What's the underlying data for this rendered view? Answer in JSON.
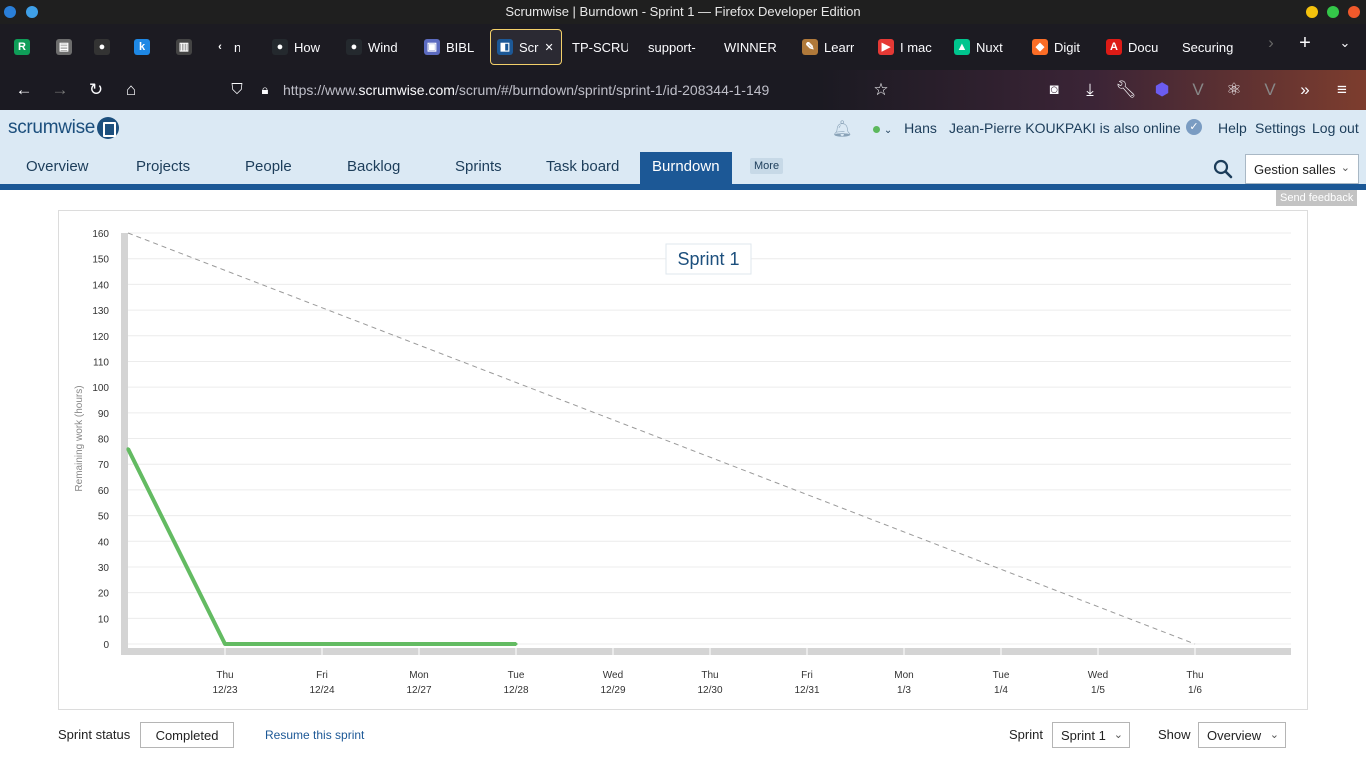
{
  "window": {
    "title": "Scrumwise | Burndown - Sprint 1 — Firefox Developer Edition"
  },
  "tabs": [
    {
      "label": "",
      "icon": "r-icon",
      "color": "#0f9d58"
    },
    {
      "label": "",
      "icon": "doc-icon",
      "color": "#6d6d6d"
    },
    {
      "label": "",
      "icon": "github-icon",
      "color": "#333333"
    },
    {
      "label": "",
      "icon": "k-icon",
      "color": "#1e88e5"
    },
    {
      "label": "",
      "icon": "notebook-icon",
      "color": "#444444"
    },
    {
      "label": "nfi",
      "icon": "chevron-left-icon",
      "color": "#1c1b22"
    },
    {
      "label": "How",
      "icon": "github-icon",
      "color": "#24292e"
    },
    {
      "label": "Wind",
      "icon": "github-icon",
      "color": "#24292e"
    },
    {
      "label": "BIBL",
      "icon": "book-icon",
      "color": "#5c6bc0"
    },
    {
      "label": "Scr",
      "icon": "scrumwise-icon",
      "color": "#1c5896",
      "active": true
    },
    {
      "label": "TP-SCRU",
      "icon": "",
      "color": ""
    },
    {
      "label": "support-",
      "icon": "",
      "color": ""
    },
    {
      "label": "WINNER",
      "icon": "",
      "color": ""
    },
    {
      "label": "Learr",
      "icon": "pen-icon",
      "color": "#b0793a"
    },
    {
      "label": "I mac",
      "icon": "youtube-icon",
      "color": "#e53935"
    },
    {
      "label": "Nuxt",
      "icon": "nuxt-icon",
      "color": "#00c58e"
    },
    {
      "label": "Digit",
      "icon": "gitlab-icon",
      "color": "#fc6d26"
    },
    {
      "label": "Docu",
      "icon": "angular-icon",
      "color": "#dd1b16"
    },
    {
      "label": "Securing",
      "icon": "",
      "color": ""
    }
  ],
  "urlbar": {
    "prefix": "https://www.",
    "domain": "scrumwise.com",
    "path": "/scrum/#/burndown/sprint/sprint-1/id-208344-1-149"
  },
  "header": {
    "logo_text": "scrumwise",
    "user": "Hans",
    "online_text": "Jean-Pierre KOUKPAKI is also online",
    "help": "Help",
    "settings": "Settings",
    "logout": "Log out",
    "status_color": "#5cb85c"
  },
  "nav": {
    "tabs": [
      "Overview",
      "Projects",
      "People",
      "Backlog",
      "Sprints",
      "Task board",
      "Burndown"
    ],
    "active": "Burndown",
    "more": "More",
    "project": "Gestion salles",
    "feedback": "Send feedback"
  },
  "chart_data": {
    "type": "line",
    "title": "Sprint 1",
    "ylabel": "Remaining work (hours)",
    "ylim": [
      0,
      160
    ],
    "yticks": [
      0,
      10,
      20,
      30,
      40,
      50,
      60,
      70,
      80,
      90,
      100,
      110,
      120,
      130,
      140,
      150,
      160
    ],
    "categories": [
      {
        "day": "Thu",
        "date": "12/23"
      },
      {
        "day": "Fri",
        "date": "12/24"
      },
      {
        "day": "Mon",
        "date": "12/27"
      },
      {
        "day": "Tue",
        "date": "12/28"
      },
      {
        "day": "Wed",
        "date": "12/29"
      },
      {
        "day": "Thu",
        "date": "12/30"
      },
      {
        "day": "Fri",
        "date": "12/31"
      },
      {
        "day": "Mon",
        "date": "1/3"
      },
      {
        "day": "Tue",
        "date": "1/4"
      },
      {
        "day": "Wed",
        "date": "1/5"
      },
      {
        "day": "Thu",
        "date": "1/6"
      }
    ],
    "ideal": {
      "start": 160,
      "end": 0
    },
    "actual": {
      "start": 76,
      "values": [
        0,
        0,
        0,
        0
      ]
    },
    "colors": {
      "actual": "#63bb62",
      "ideal": "#9a9a9a"
    }
  },
  "footer": {
    "sprint_status_label": "Sprint status",
    "sprint_status_value": "Completed",
    "resume_link": "Resume this sprint",
    "sprint_label": "Sprint",
    "sprint_value": "Sprint 1",
    "show_label": "Show",
    "show_value": "Overview"
  }
}
